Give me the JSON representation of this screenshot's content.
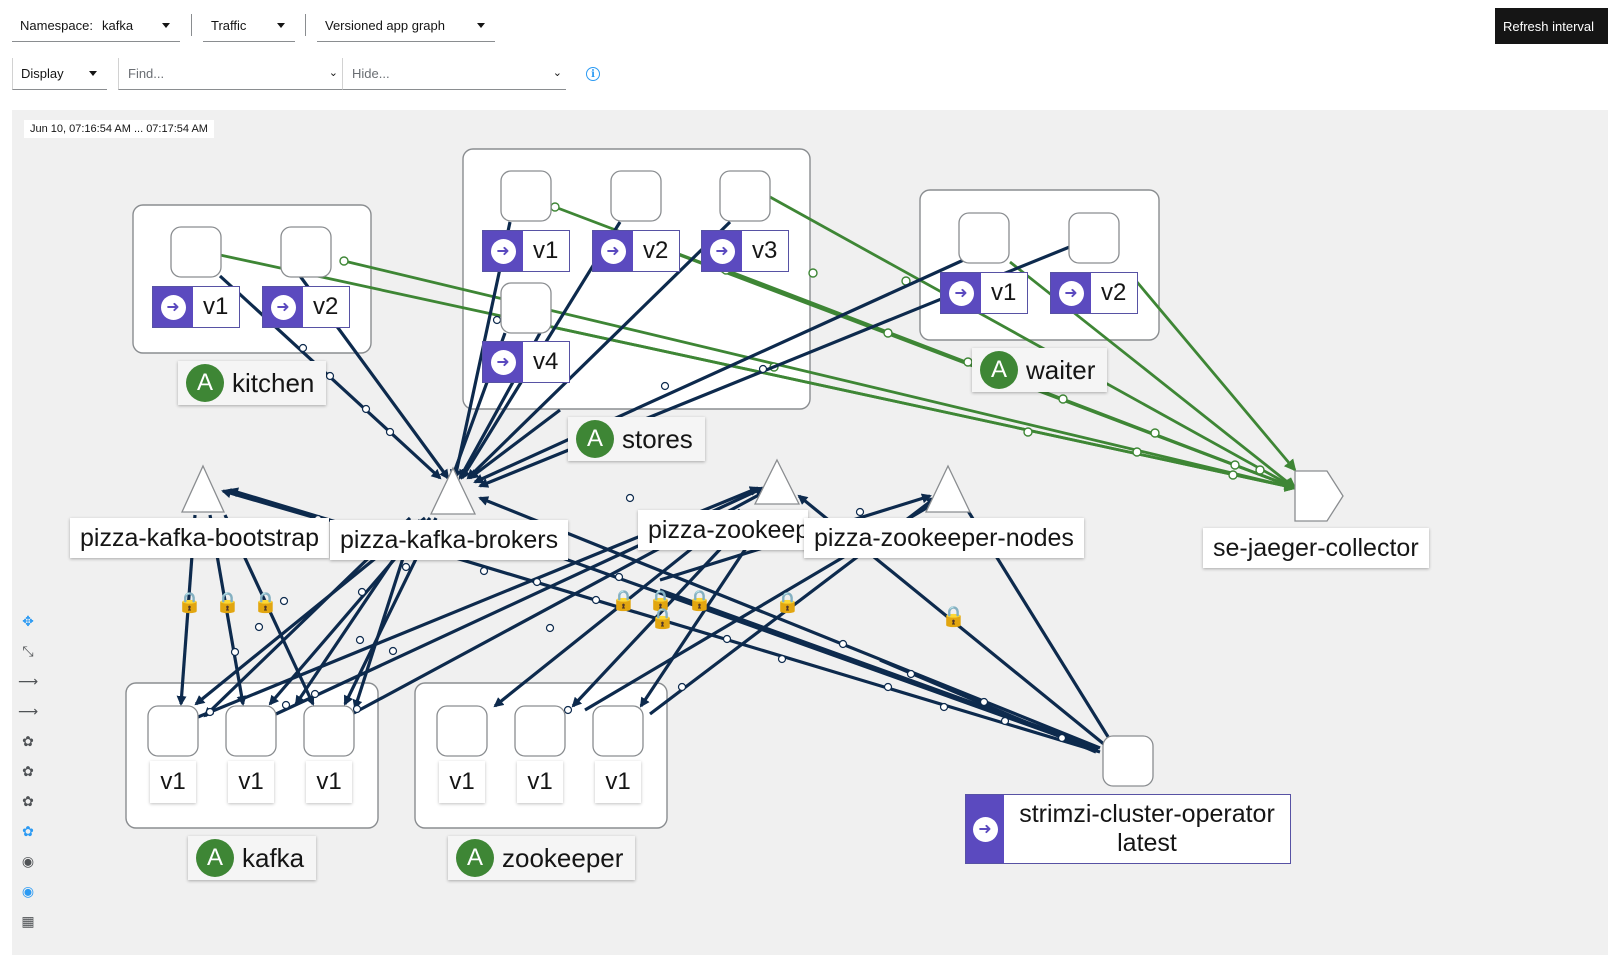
{
  "toolbar": {
    "namespace_label": "Namespace:",
    "namespace_value": "kafka",
    "traffic_label": "Traffic",
    "graph_type": "Versioned app graph",
    "display_label": "Display",
    "find_placeholder": "Find...",
    "hide_placeholder": "Hide...",
    "refresh_label": "Refresh interval"
  },
  "graph": {
    "timestamp": "Jun 10, 07:16:54 AM ... 07:17:54 AM",
    "apps": {
      "kitchen": "kitchen",
      "stores": "stores",
      "waiter": "waiter",
      "kafka": "kafka",
      "zookeeper": "zookeeper"
    },
    "versions": {
      "kitchen_v1": "v1",
      "kitchen_v2": "v2",
      "stores_v1": "v1",
      "stores_v2": "v2",
      "stores_v3": "v3",
      "stores_v4": "v4",
      "waiter_v1": "v1",
      "waiter_v2": "v2",
      "kafka_v1a": "v1",
      "kafka_v1b": "v1",
      "kafka_v1c": "v1",
      "zk_v1a": "v1",
      "zk_v1b": "v1",
      "zk_v1c": "v1"
    },
    "services": {
      "bootstrap": "pizza-kafka-bootstrap",
      "brokers": "pizza-kafka-brokers",
      "zookeeper_client": "pizza-zookeep",
      "zookeeper_nodes": "pizza-zookeeper-nodes",
      "jaeger": "se-jaeger-collector"
    },
    "operator": {
      "name": "strimzi-cluster-operator",
      "version": "latest"
    },
    "colors": {
      "healthy_edge": "#3e8635",
      "tcp_edge": "#0d2a4d",
      "version_chip": "#5b4abf",
      "app_badge": "#3e8635"
    }
  },
  "controls": [
    "move-icon",
    "fit-icon",
    "arrow-right-icon",
    "arrow-right-icon",
    "layout-1-icon",
    "layout-2-icon",
    "layout-3-icon",
    "layout-4-icon",
    "legend-icon",
    "legend-active-icon",
    "map-icon"
  ]
}
